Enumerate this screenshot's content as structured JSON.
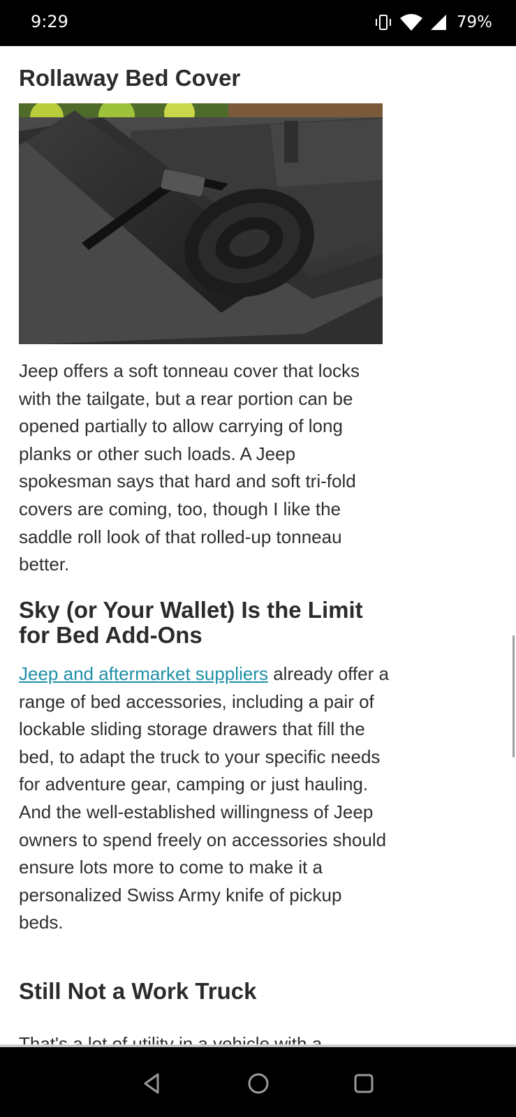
{
  "status_bar": {
    "time": "9:29",
    "battery": "79%",
    "icons": [
      "vibrate-icon",
      "wifi-icon",
      "signal-icon"
    ]
  },
  "article": {
    "heading_1": "Rollaway Bed Cover",
    "image_alt": "Rolled-up soft tonneau cover in a Jeep truck bed",
    "para_1": "Jeep offers a soft tonneau cover that locks with the tailgate, but a rear portion can be opened partially to allow carrying of long planks or other such loads. A Jeep spokesman says that hard and soft tri-fold covers are coming, too, though I like the saddle roll look of that rolled-up tonneau better.",
    "heading_2": "Sky (or Your Wallet) Is the Limit for Bed Add-Ons",
    "para_2_link": "Jeep and aftermarket suppliers",
    "para_2_rest": " already offer a range of bed accessories, including a pair of lockable sliding storage drawers that fill the bed, to adapt the truck to your specific needs for adventure gear, camping or just hauling. And the well-established willingness of Jeep owners to spend freely on accessories should ensure lots more to come to make it a personalized Swiss Army knife of pickup beds.",
    "heading_3": "Still Not a Work Truck",
    "para_3": "That's a lot of utility in a vehicle with a"
  },
  "colors": {
    "link": "#1f8fa6",
    "text": "#2e2e2e",
    "bars": "#000000"
  },
  "nav_bar": {
    "icons": [
      "back-icon",
      "home-icon",
      "recents-icon"
    ]
  }
}
